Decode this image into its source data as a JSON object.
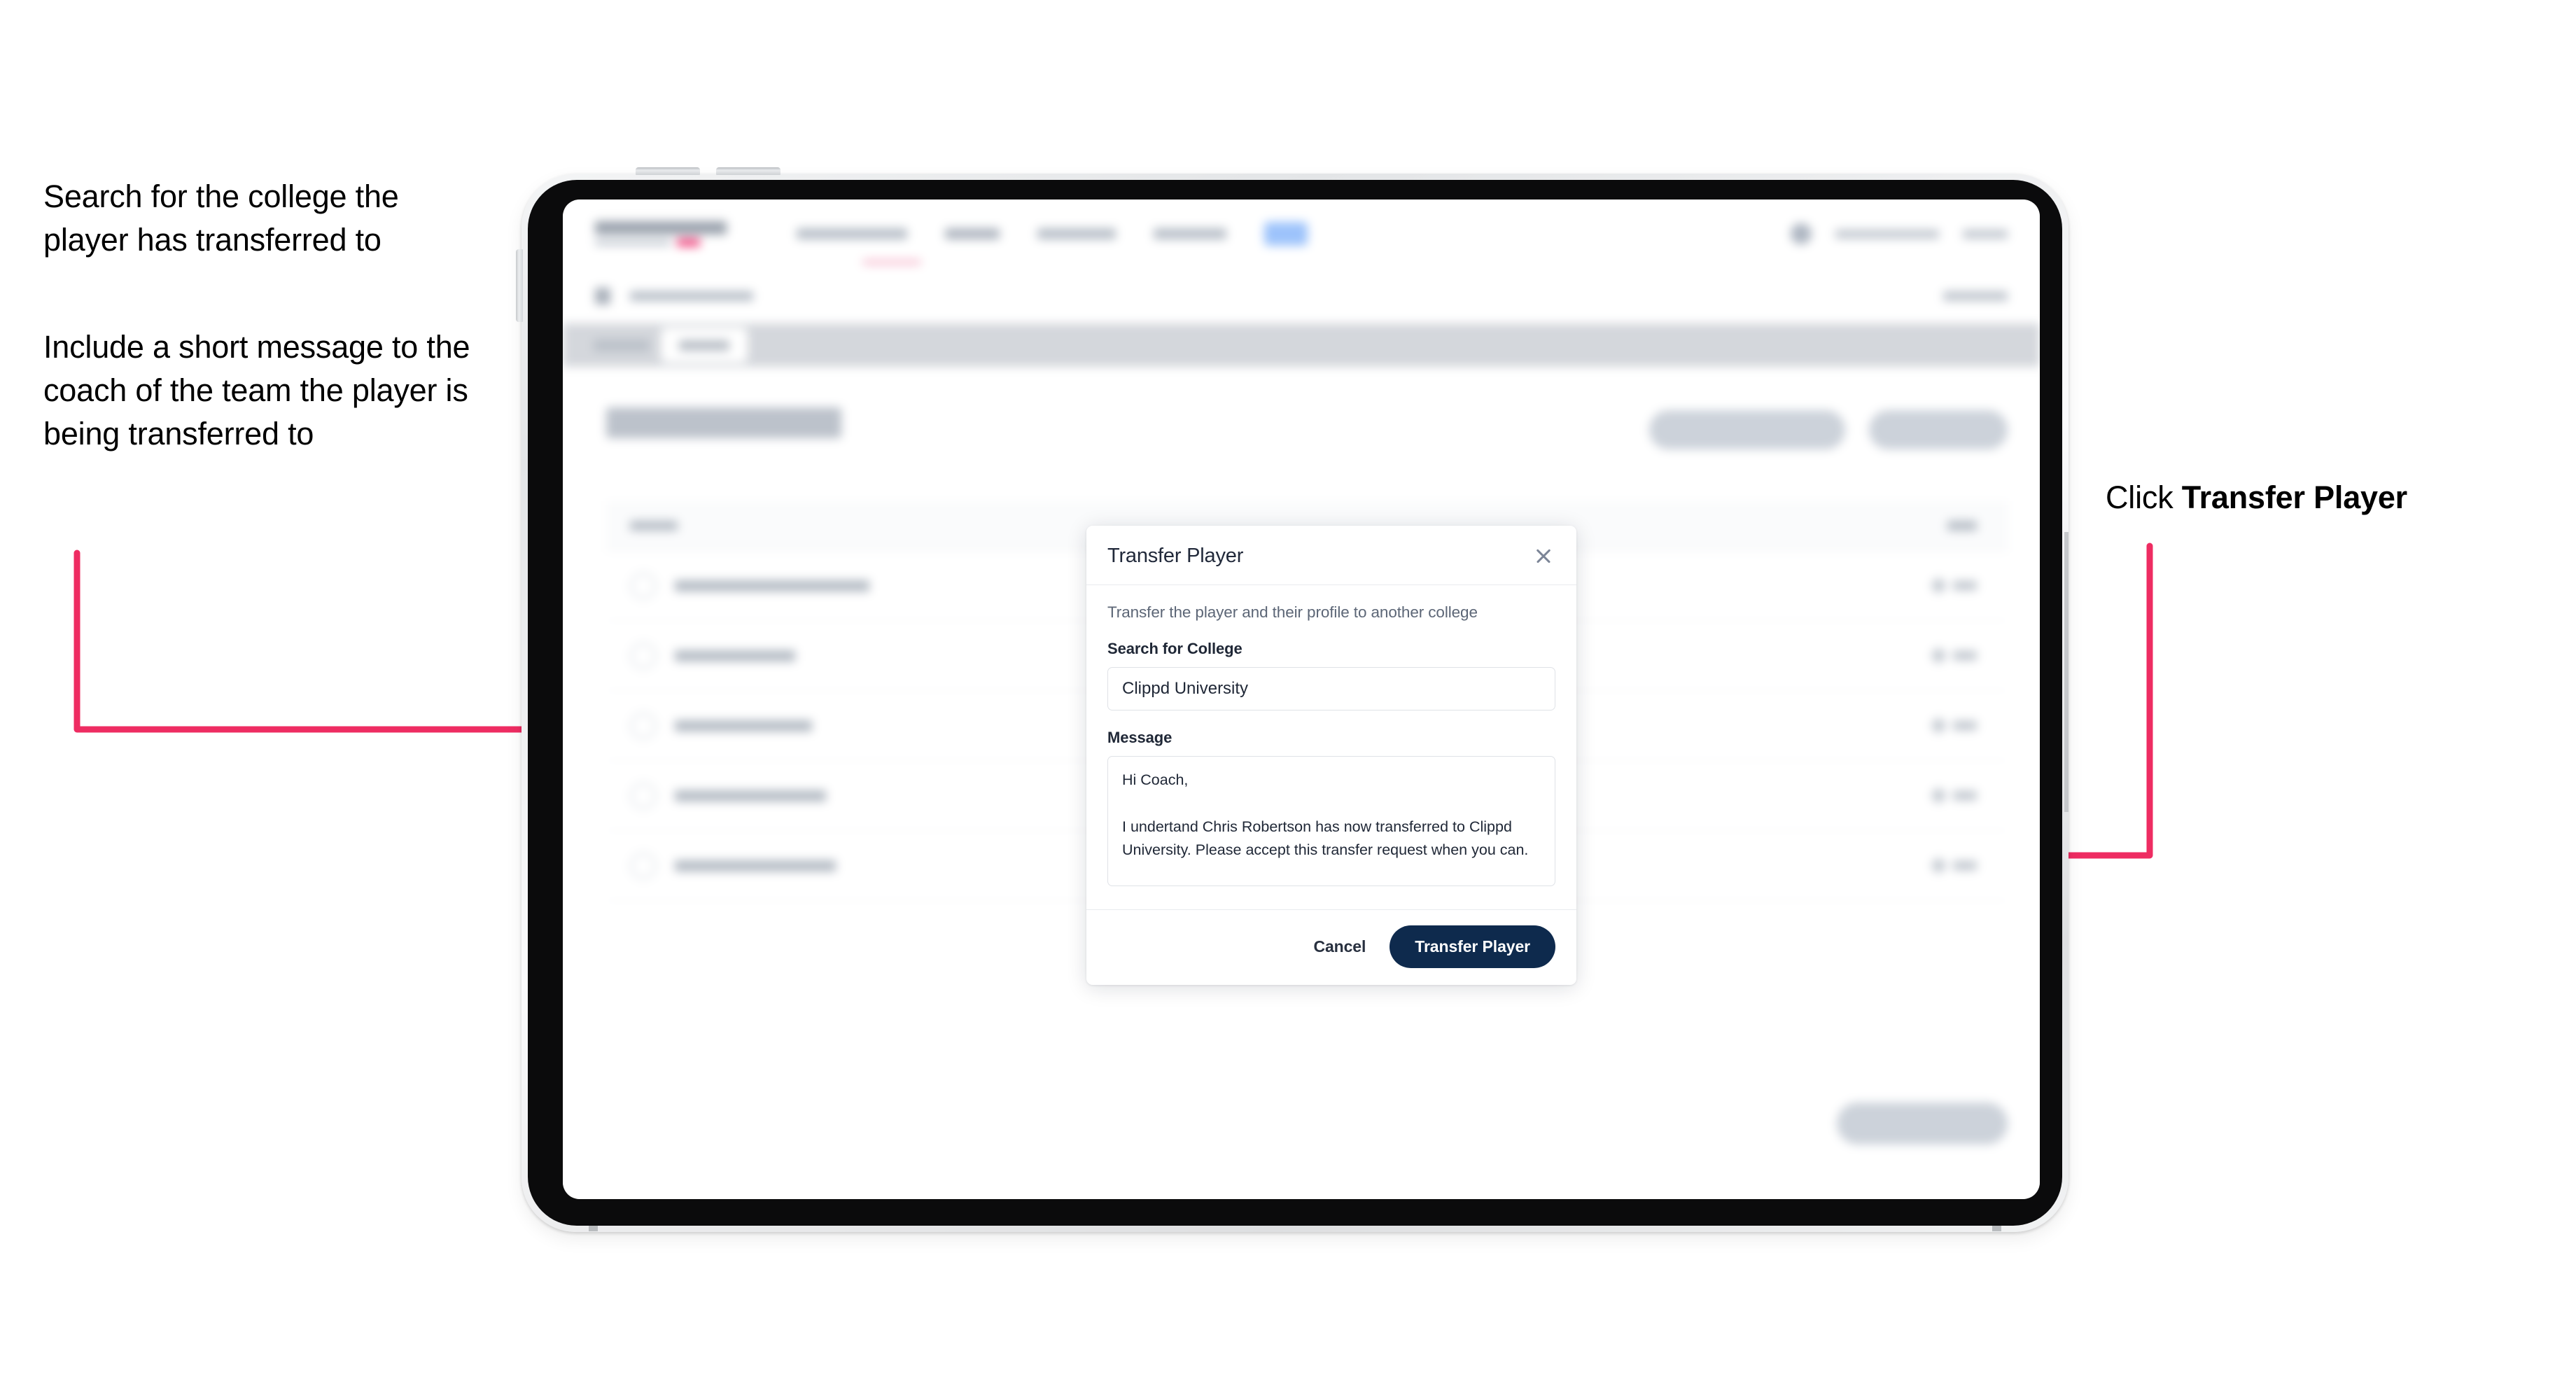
{
  "annotations": {
    "left_1": "Search for the college the player has transferred to",
    "left_2": "Include a short message to the coach of the team the player is being transferred to",
    "right_prefix": "Click ",
    "right_bold": "Transfer Player"
  },
  "modal": {
    "title": "Transfer Player",
    "close_icon": "close-icon",
    "description": "Transfer the player and their profile to another college",
    "college_field": {
      "label": "Search for College",
      "value": "Clippd University",
      "placeholder": "Search for College"
    },
    "message_field": {
      "label": "Message",
      "value": "Hi Coach,\n\nI undertand Chris Robertson has now transferred to Clippd University. Please accept this transfer request when you can.",
      "placeholder": "Message"
    },
    "cancel_label": "Cancel",
    "submit_label": "Transfer Player"
  },
  "colors": {
    "accent_pink": "#EE2C62",
    "brand_navy": "#0E2A4D",
    "logo_pink": "#F0427C",
    "nav_badge_blue": "#9DC3FB"
  },
  "background_app": {
    "note": "blurred behind modal",
    "table_rows": 5,
    "nav_items": 5,
    "subnav_tabs": 2,
    "page_actions": 2
  }
}
